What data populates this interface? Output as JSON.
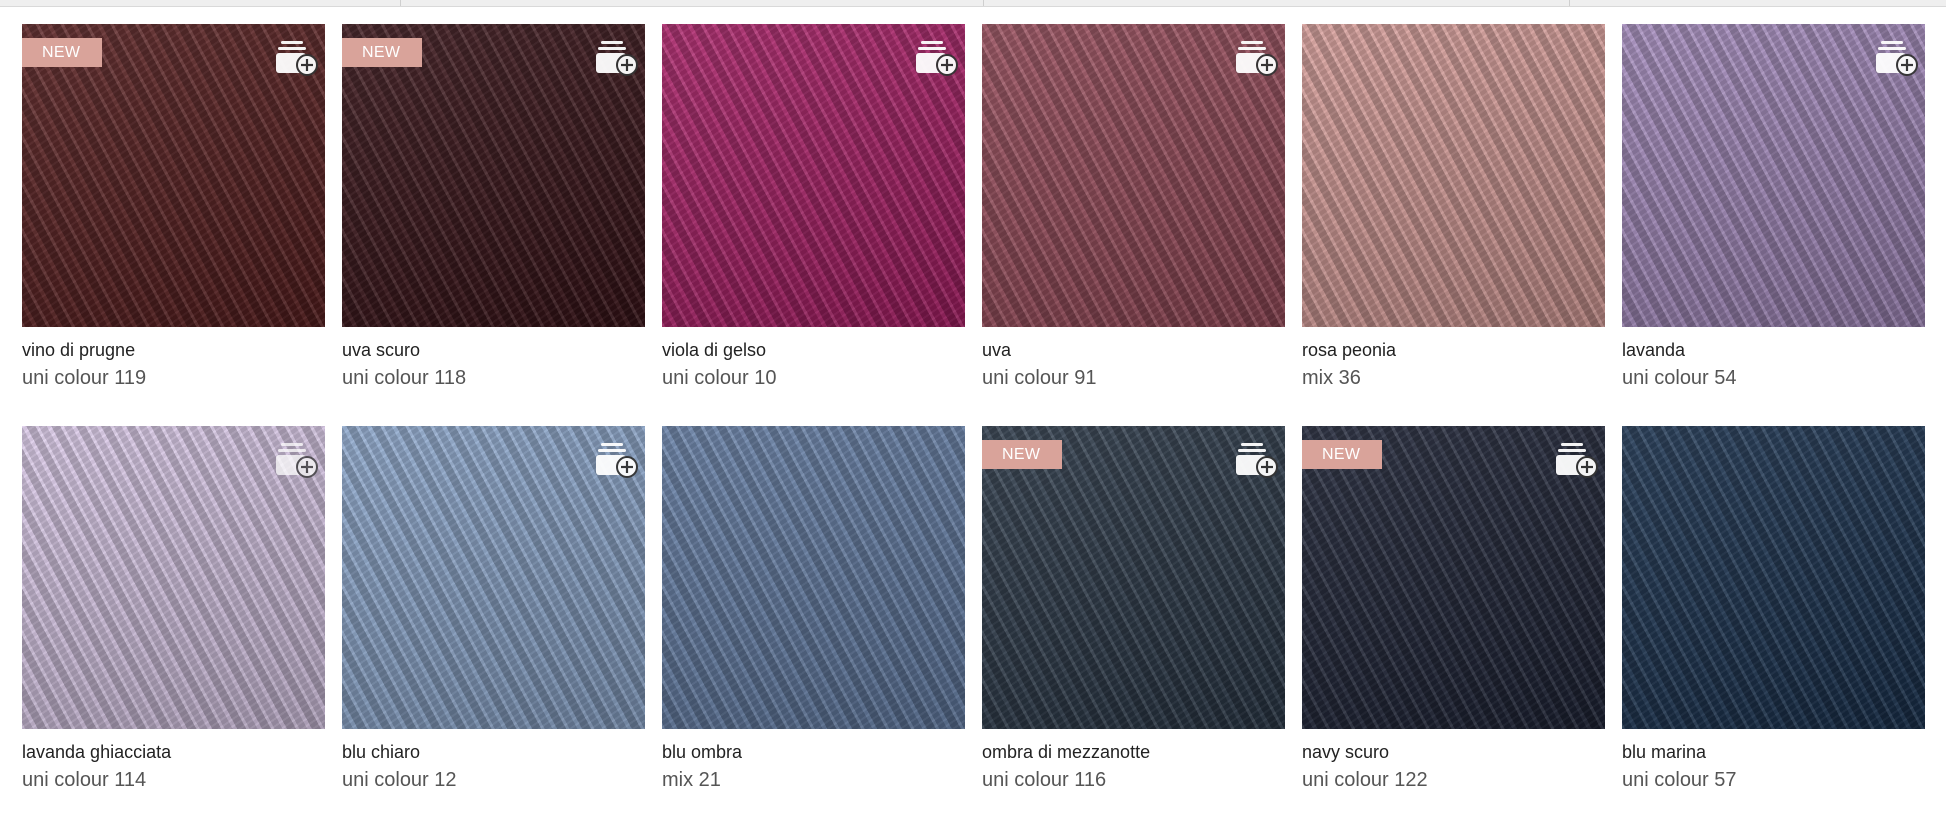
{
  "colors": {
    "badge": "#d9a39a",
    "name_text": "#222222",
    "code_text": "#555555"
  },
  "icons": {
    "add_to_cart": "stack-plus-icon"
  },
  "swatches": [
    {
      "name": "vino di prugne",
      "code": "uni colour 119",
      "badge": "NEW",
      "color": "#5a1f20",
      "has_add_icon": true
    },
    {
      "name": "uva scuro",
      "code": "uni colour 118",
      "badge": "NEW",
      "color": "#3b1419",
      "has_add_icon": true
    },
    {
      "name": "viola di gelso",
      "code": "uni colour 10",
      "badge": "",
      "color": "#ac1f68",
      "has_add_icon": true
    },
    {
      "name": "uva",
      "code": "uni colour 91",
      "badge": "",
      "color": "#9a4d5c",
      "has_add_icon": true
    },
    {
      "name": "rosa peonia",
      "code": "mix 36",
      "badge": "",
      "color": "#d99e9a",
      "has_add_icon": false
    },
    {
      "name": "lavanda",
      "code": "uni colour 54",
      "badge": "",
      "color": "#a68cbf",
      "has_add_icon": true
    },
    {
      "name": "lavanda ghiacciata",
      "code": "uni colour 114",
      "badge": "",
      "color": "#dccbea",
      "has_add_icon": true
    },
    {
      "name": "blu chiaro",
      "code": "uni colour 12",
      "badge": "",
      "color": "#8ea9cf",
      "has_add_icon": true
    },
    {
      "name": "blu ombra",
      "code": "mix 21",
      "badge": "",
      "color": "#6680a8",
      "has_add_icon": false
    },
    {
      "name": "ombra di mezzanotte",
      "code": "uni colour 116",
      "badge": "NEW",
      "color": "#2d3b4b",
      "has_add_icon": true
    },
    {
      "name": "navy scuro",
      "code": "uni colour 122",
      "badge": "NEW",
      "color": "#1f2538",
      "has_add_icon": true
    },
    {
      "name": "blu marina",
      "code": "uni colour 57",
      "badge": "",
      "color": "#1b3452",
      "has_add_icon": false
    }
  ]
}
